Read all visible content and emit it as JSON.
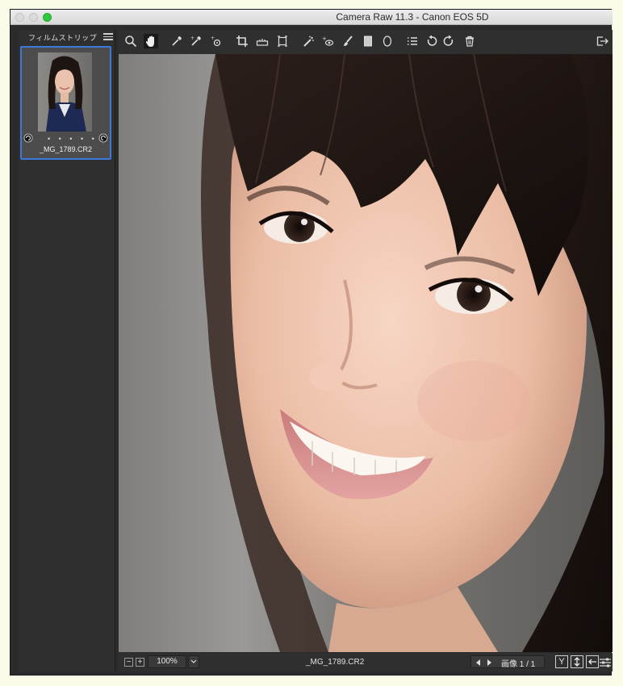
{
  "window": {
    "title": "Camera Raw 11.3  -  Canon EOS 5D"
  },
  "filmstrip": {
    "title": "フィルムストリップ",
    "menu_icon": "hamburger-icon",
    "items": [
      {
        "filename": "_MG_1789.CR2",
        "rating_dots": "• • • • •",
        "selected": true
      }
    ]
  },
  "toolbar": {
    "tools": [
      "zoom-tool-icon",
      "hand-tool-icon",
      "white-balance-tool-icon",
      "color-sampler-tool-icon",
      "targeted-adjustment-tool-icon",
      "crop-tool-icon",
      "straighten-tool-icon",
      "transform-tool-icon",
      "spot-removal-tool-icon",
      "red-eye-removal-icon",
      "adjustment-brush-icon",
      "graduated-filter-icon",
      "radial-filter-icon",
      "preferences-icon",
      "rotate-ccw-icon",
      "rotate-cw-icon",
      "trash-icon",
      "fullscreen-toggle-icon"
    ],
    "active_tool": "hand-tool-icon"
  },
  "statusbar": {
    "zoom_out": "−",
    "zoom_in": "+",
    "zoom_value": "100%",
    "filename": "_MG_1789.CR2",
    "image_count": "画像 1 / 1",
    "before_after_label": "Y"
  },
  "colors": {
    "accent": "#3d78d8",
    "panel": "#2f2f2f",
    "maximize": "#2fc840"
  }
}
